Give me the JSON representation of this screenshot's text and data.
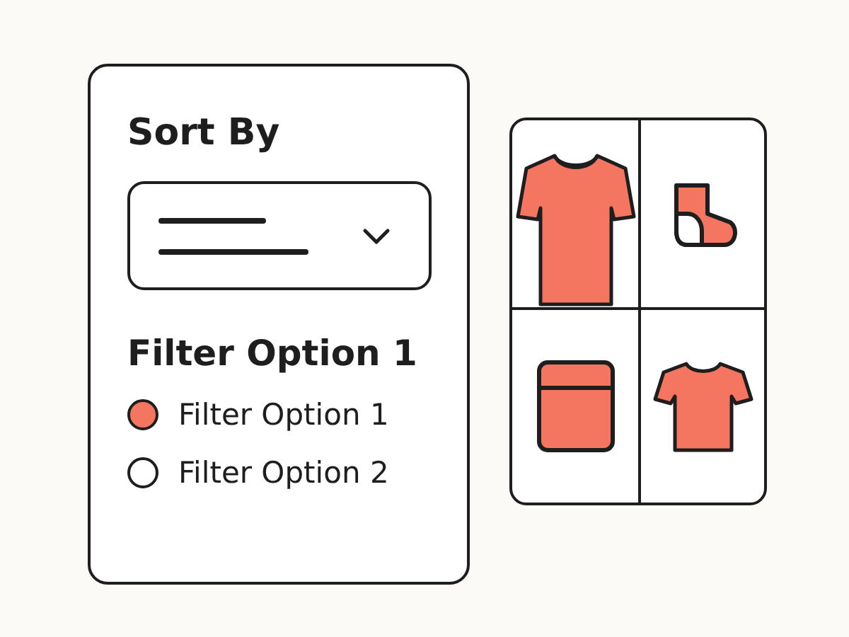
{
  "sort_panel": {
    "title": "Sort By",
    "filter_heading": "Filter Option 1",
    "options": [
      {
        "label": "Filter Option 1",
        "selected": true
      },
      {
        "label": "Filter Option 2",
        "selected": false
      }
    ]
  }
}
